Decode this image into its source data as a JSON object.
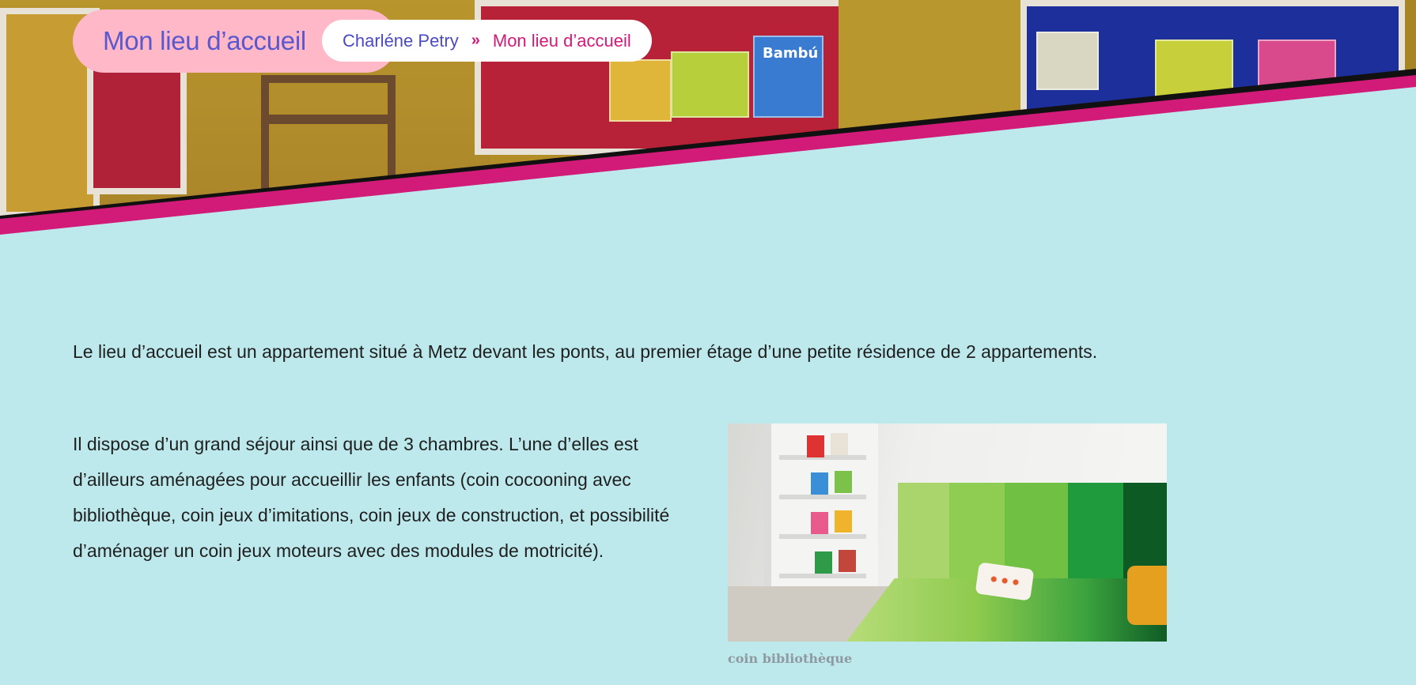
{
  "header": {
    "page_title": "Mon lieu d’accueil",
    "breadcrumb": {
      "home_label": "Charléne Petry",
      "separator": "»",
      "current_label": "Mon lieu d’accueil"
    },
    "hero_books": [
      "Bambú"
    ]
  },
  "main": {
    "intro": "Le lieu d’accueil est un appartement situé à Metz devant les ponts, au premier étage d’une petite résidence de 2 appartements.",
    "description": "Il dispose d’un grand séjour ainsi que de 3 chambres. L’une d’elles est d’ailleurs aménagées pour accueillir les enfants (coin cocooning avec bibliothèque, coin jeux d’imitations, coin jeux de construction, et possibilité d’aménager un coin jeux moteurs avec des modules de motricité).",
    "figure": {
      "caption": "coin bibliothèque"
    }
  },
  "colors": {
    "background": "#bde9ec",
    "accent_pink": "#d21a78",
    "title_pill": "#ffb8c7",
    "title_text": "#5a58cf"
  }
}
